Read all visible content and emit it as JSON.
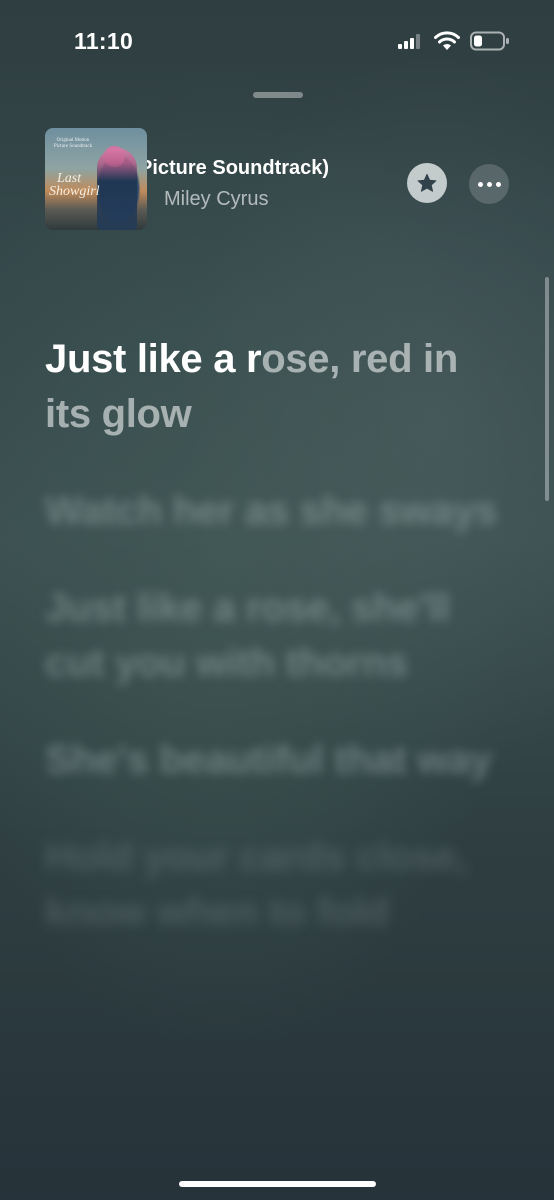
{
  "status_bar": {
    "time": "11:10",
    "signal_icon": "cellular-signal-icon",
    "wifi_icon": "wifi-icon",
    "battery_icon": "battery-low-icon"
  },
  "now_playing": {
    "title": "Picture Soundtrack)",
    "artist": "Miley Cyrus",
    "album_art": {
      "top_text": "Original Motion Picture Soundtrack",
      "title_line1": "Last",
      "title_line2": "Showgirl"
    },
    "favorite_icon": "star-icon",
    "more_icon": "ellipsis-icon"
  },
  "lyrics": {
    "active": {
      "sung": "Just like a r",
      "unsung": "ose, red in its glow"
    },
    "upcoming": [
      "Watch her as she sways",
      "Just like a rose, she'll cut you with thorns",
      "She's beautiful that way",
      "Hold your cards close, know when to fold"
    ]
  },
  "colors": {
    "background_top": "#2f3e40",
    "background_bottom": "#26333a",
    "lyric_sung": "#ffffff"
  }
}
